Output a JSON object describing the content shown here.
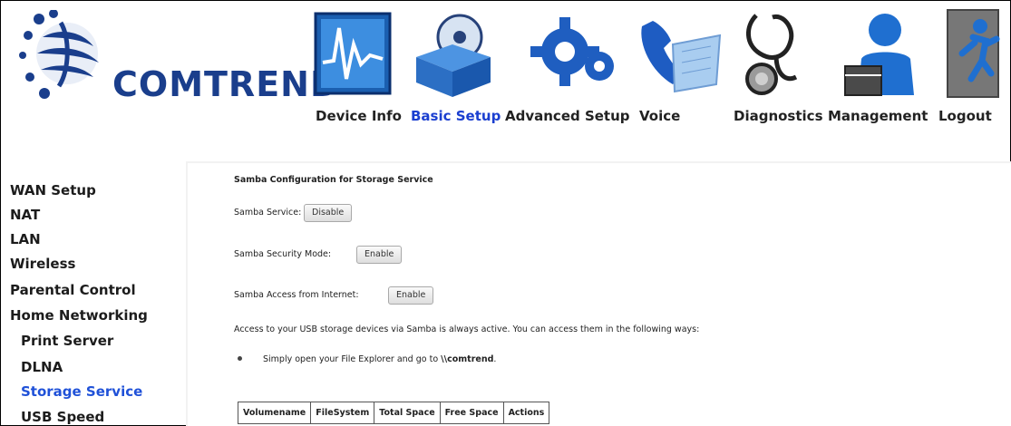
{
  "brand": {
    "name": "COMTREND"
  },
  "nav": {
    "items": [
      {
        "label": "Device Info",
        "icon": "device-info-chart-icon"
      },
      {
        "label": "Basic Setup",
        "icon": "basic-setup-box-icon",
        "active": true
      },
      {
        "label": "Advanced Setup",
        "icon": "advanced-setup-gear-icon"
      },
      {
        "label": "Voice",
        "icon": "voice-phone-icon"
      },
      {
        "label": "Diagnostics",
        "icon": "diagnostics-stethoscope-icon"
      },
      {
        "label": "Management",
        "icon": "management-user-icon"
      },
      {
        "label": "Logout",
        "icon": "logout-running-man-icon"
      }
    ]
  },
  "sidebar": {
    "items": [
      {
        "label": "WAN Setup"
      },
      {
        "label": "NAT"
      },
      {
        "label": "LAN"
      },
      {
        "label": "Wireless"
      },
      {
        "label": "Parental Control"
      },
      {
        "label": "Home Networking"
      },
      {
        "label": "Print Server",
        "sub": true
      },
      {
        "label": "DLNA",
        "sub": true
      },
      {
        "label": "Storage Service",
        "sub": true,
        "active": true
      },
      {
        "label": "USB Speed",
        "sub": true
      }
    ]
  },
  "main": {
    "title": "Samba Configuration for Storage Service",
    "samba_service_label": "Samba Service:",
    "samba_service_button": "Disable",
    "security_mode_label": "Samba Security Mode:",
    "security_mode_button": "Enable",
    "access_internet_label": "Samba Access from Internet:",
    "access_internet_button": "Enable",
    "info_text": "Access to your USB storage devices via Samba is always active. You can access them in the following ways:",
    "bullet_prefix": "Simply open your File Explorer and go to ",
    "bullet_path": "\\\\comtrend",
    "bullet_suffix": ".",
    "table": {
      "headers": [
        "Volumename",
        "FileSystem",
        "Total Space",
        "Free Space",
        "Actions"
      ]
    }
  },
  "colors": {
    "brand": "#1a3e8c",
    "nav_active": "#1b3fd0",
    "sidebar_active": "#1f51d8"
  }
}
